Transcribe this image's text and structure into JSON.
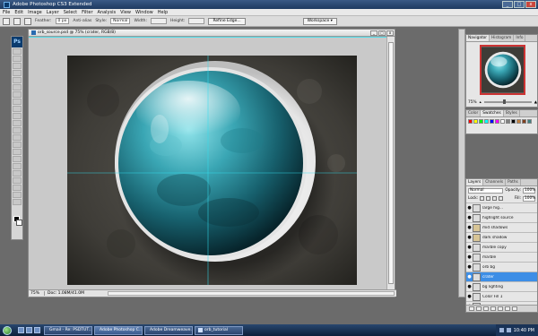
{
  "app": {
    "title": "Adobe Photoshop CS3 Extended",
    "window_buttons": [
      "_",
      "□",
      "x"
    ]
  },
  "menu": [
    "File",
    "Edit",
    "Image",
    "Layer",
    "Select",
    "Filter",
    "Analysis",
    "View",
    "Window",
    "Help"
  ],
  "options": {
    "feather_label": "Feather:",
    "feather_value": "0 px",
    "antialias_label": "Anti-alias",
    "style_label": "Style:",
    "style_value": "Normal",
    "width_label": "Width:",
    "height_label": "Height:",
    "refine_edge": "Refine Edge...",
    "workspace": "Workspace ▾"
  },
  "document": {
    "title": "orb_source.psd @ 75% (crater, RGB/8)",
    "zoom": "75%",
    "doc_size": "Doc: 1.08M/41.0M",
    "buttons": [
      "_",
      "□",
      "x"
    ]
  },
  "navigator": {
    "tabs": [
      "Navigator",
      "Histogram",
      "Info"
    ],
    "zoom": "75%"
  },
  "color_panel": {
    "tabs": [
      "Color",
      "Swatches",
      "Styles"
    ],
    "swatches": [
      "#ff0000",
      "#ffff00",
      "#00ff00",
      "#00ffff",
      "#0000ff",
      "#ff00ff",
      "#ffffff",
      "#808080",
      "#000000",
      "#c08040",
      "#804020",
      "#408080"
    ]
  },
  "layers": {
    "tabs": [
      "Layers",
      "Channels",
      "Paths"
    ],
    "blend_mode": "Normal",
    "opacity_label": "Opacity:",
    "opacity_value": "100%",
    "fill_label": "Fill:",
    "fill_value": "100%",
    "lock_label": "Lock:",
    "items": [
      {
        "name": "large hig...",
        "type": "layer",
        "active": false
      },
      {
        "name": "highlight source",
        "type": "layer",
        "active": false
      },
      {
        "name": "mid shadows",
        "type": "folder",
        "active": false
      },
      {
        "name": "dark shadow",
        "type": "folder",
        "active": false
      },
      {
        "name": "marble copy",
        "type": "layer",
        "active": false
      },
      {
        "name": "marble",
        "type": "layer",
        "active": false
      },
      {
        "name": "orb bg",
        "type": "layer",
        "active": false
      },
      {
        "name": "crater",
        "type": "layer",
        "active": true
      },
      {
        "name": "bg lighting",
        "type": "layer",
        "active": false
      },
      {
        "name": "Color Fill 1",
        "type": "layer",
        "active": false
      },
      {
        "name": "Background",
        "type": "layer",
        "active": false
      }
    ]
  },
  "taskbar": {
    "tasks": [
      {
        "label": "Gmail - Re: PSDTUT...",
        "active": false
      },
      {
        "label": "Adobe Photoshop C...",
        "active": true
      },
      {
        "label": "Adobe Dreamweave...",
        "active": false
      },
      {
        "label": "orb_tutorial",
        "active": false
      }
    ],
    "time": "10:40 PM"
  }
}
